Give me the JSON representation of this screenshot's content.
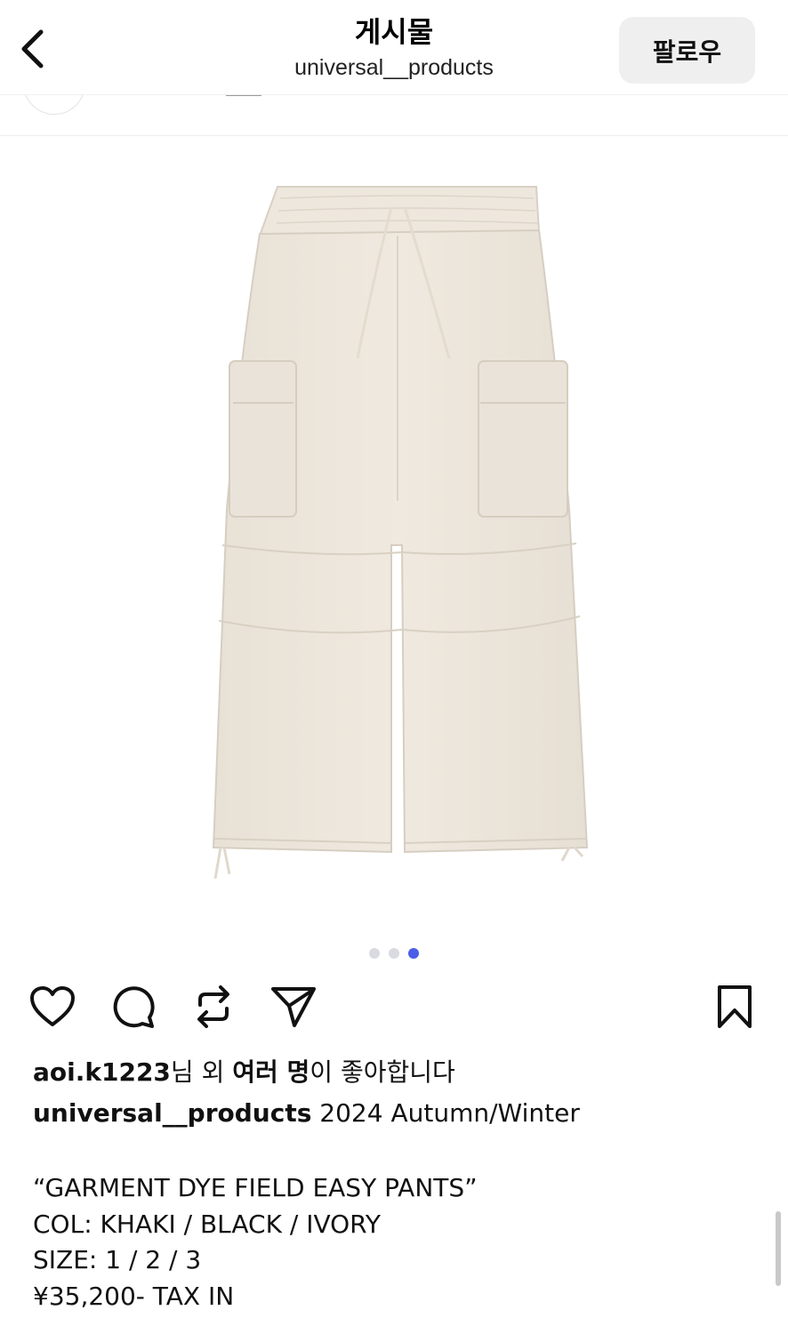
{
  "header": {
    "title": "게시물",
    "subtitle": "universal__products",
    "follow_label": "팔로우",
    "back_icon": "chevron-left-icon"
  },
  "post": {
    "image_alt": "Ivory cargo pants",
    "carousel": {
      "count": 3,
      "active_index": 3
    },
    "colors": {
      "pants": "#ece6dc",
      "active_dot": "#4a5ee8",
      "inactive_dot": "#d9dbe0"
    }
  },
  "actions": {
    "like_icon": "heart-icon",
    "comment_icon": "comment-icon",
    "repost_icon": "repost-icon",
    "share_icon": "send-icon",
    "save_icon": "bookmark-icon"
  },
  "likes": {
    "user": "aoi.k1223",
    "text_a": "님 외 ",
    "others": "여러 명",
    "text_b": "이 좋아합니다"
  },
  "caption": {
    "username": "universal__products",
    "first_line": " 2024 Autumn/Winter",
    "lines": [
      "“GARMENT DYE FIELD EASY PANTS”",
      "COL: KHAKI / BLACK / IVORY",
      "SIZE: 1 / 2 / 3",
      "¥35,200- TAX IN"
    ]
  }
}
